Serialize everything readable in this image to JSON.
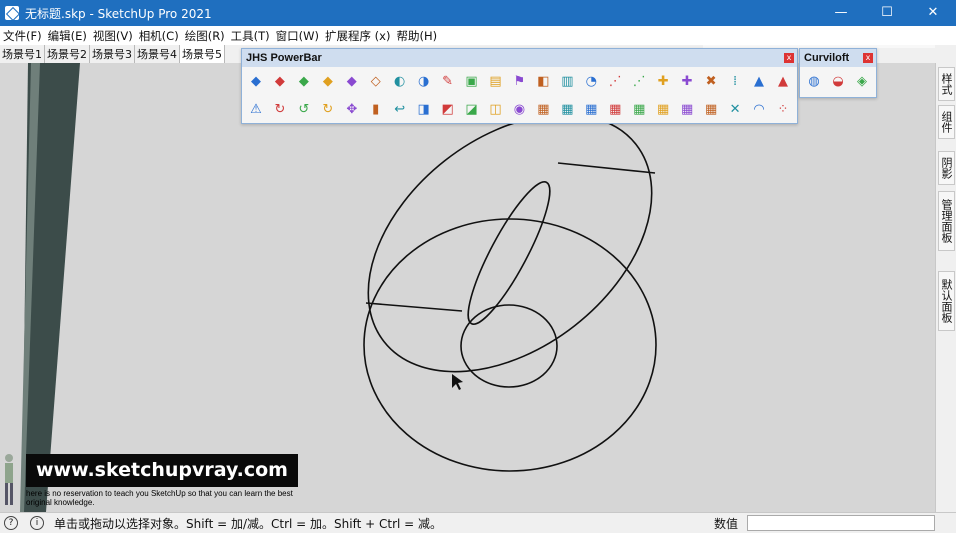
{
  "window": {
    "title": "无标题.skp - SketchUp Pro 2021",
    "minimize": "—",
    "maximize": "☐",
    "close": "✕"
  },
  "menu": [
    "文件(F)",
    "编辑(E)",
    "视图(V)",
    "相机(C)",
    "绘图(R)",
    "工具(T)",
    "窗口(W)",
    "扩展程序 (x)",
    "帮助(H)"
  ],
  "scene_tabs": [
    "场景号1",
    "场景号2",
    "场景号3",
    "场景号4",
    "场景号5"
  ],
  "active_scene_index": 4,
  "jhs": {
    "title": "JHS PowerBar",
    "close": "x",
    "row1": [
      "◆",
      "◆",
      "◆",
      "◆",
      "◆",
      "◇",
      "◐",
      "◑",
      "✎",
      "▣",
      "▤",
      "⚑",
      "◧",
      "▥",
      "◔",
      "⋰",
      "⋰",
      "✚",
      "✚",
      "✖",
      "⁞",
      "▲",
      "▲"
    ],
    "row2": [
      "⚠",
      "↻",
      "↺",
      "↻",
      "✥",
      "▮",
      "↩",
      "◨",
      "◩",
      "◪",
      "◫",
      "◉",
      "▦",
      "▦",
      "▦",
      "▦",
      "▦",
      "▦",
      "▦",
      "▦",
      "✕",
      "◠",
      "⁘"
    ]
  },
  "curviloft": {
    "title": "Curviloft",
    "close": "x",
    "icons": [
      "◍",
      "◒",
      "◈"
    ]
  },
  "right_tabs": [
    "样式",
    "组件",
    "阴影",
    "管理面板",
    "默认面板"
  ],
  "status": {
    "message": "单击或拖动以选择对象。Shift = 加/减。Ctrl = 加。Shift + Ctrl = 减。",
    "value_label": "数值",
    "icon1": "?",
    "icon2": "i"
  },
  "watermark": {
    "url": "www.sketchupvray.com",
    "tagline": "here is no reservation to teach you SketchUp so that you can learn the best original knowledge."
  },
  "colors": {
    "titlebar": "#1f6fbf",
    "viewport": "#d6d6d6",
    "toolbar_header": "#cfddef"
  }
}
